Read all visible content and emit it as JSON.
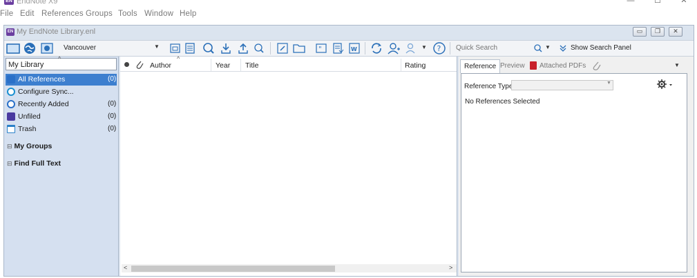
{
  "app": {
    "title": "EndNote X9",
    "icon_text": "EN",
    "controls": {
      "minimize": "—",
      "maximize": "☐",
      "close": "✕"
    }
  },
  "menu": [
    "File",
    "Edit",
    "References",
    "Groups",
    "Tools",
    "Window",
    "Help"
  ],
  "document": {
    "title": "My EndNote Library.enl",
    "icon_text": "EN"
  },
  "toolbar": {
    "style_value": "Vancouver",
    "quick_search_placeholder": "Quick Search",
    "show_search_panel_label": "Show Search Panel",
    "icons": [
      "local-library-icon",
      "online-search-icon",
      "integrated-library-icon",
      "new-reference-icon",
      "preview-icon",
      "find-full-text-icon",
      "import-icon",
      "export-icon",
      "find-pdf-icon",
      "open-link-icon",
      "open-file-icon",
      "insert-citation-icon",
      "format-bibliography-icon",
      "word-icon",
      "sync-icon",
      "share-icon",
      "group-icon",
      "help-icon"
    ]
  },
  "library_selector": {
    "label": "My Library"
  },
  "groups": [
    {
      "label": "All References",
      "count": "(0)",
      "icon": "all-references-icon",
      "color": "#2a70c8",
      "selected": true
    },
    {
      "label": "Configure Sync...",
      "count": "",
      "icon": "sync-icon",
      "color": "#1a8fd0",
      "selected": false
    },
    {
      "label": "Recently Added",
      "count": "(0)",
      "icon": "recently-added-icon",
      "color": "#2a70c8",
      "selected": false
    },
    {
      "label": "Unfiled",
      "count": "(0)",
      "icon": "unfiled-icon",
      "color": "#4a3aa0",
      "selected": false
    },
    {
      "label": "Trash",
      "count": "(0)",
      "icon": "trash-icon",
      "color": "#2a80c8",
      "selected": false
    }
  ],
  "sections": [
    {
      "expander": "⊟",
      "label": "My Groups"
    },
    {
      "expander": "⊟",
      "label": "Find Full Text"
    }
  ],
  "columns": {
    "author": "Author",
    "year": "Year",
    "title": "Title",
    "rating": "Rating"
  },
  "tabs": [
    {
      "label": "Reference",
      "active": true
    },
    {
      "label": "Preview",
      "active": false
    },
    {
      "label": "Attached PDFs",
      "active": false
    }
  ],
  "reference_panel": {
    "type_label": "Reference Type:",
    "type_value": "",
    "empty_message": "No References Selected"
  },
  "colors": {
    "selection": "#3d7fcf",
    "left_panel": "#d5e0f0",
    "brand": "#6b3fa0"
  }
}
